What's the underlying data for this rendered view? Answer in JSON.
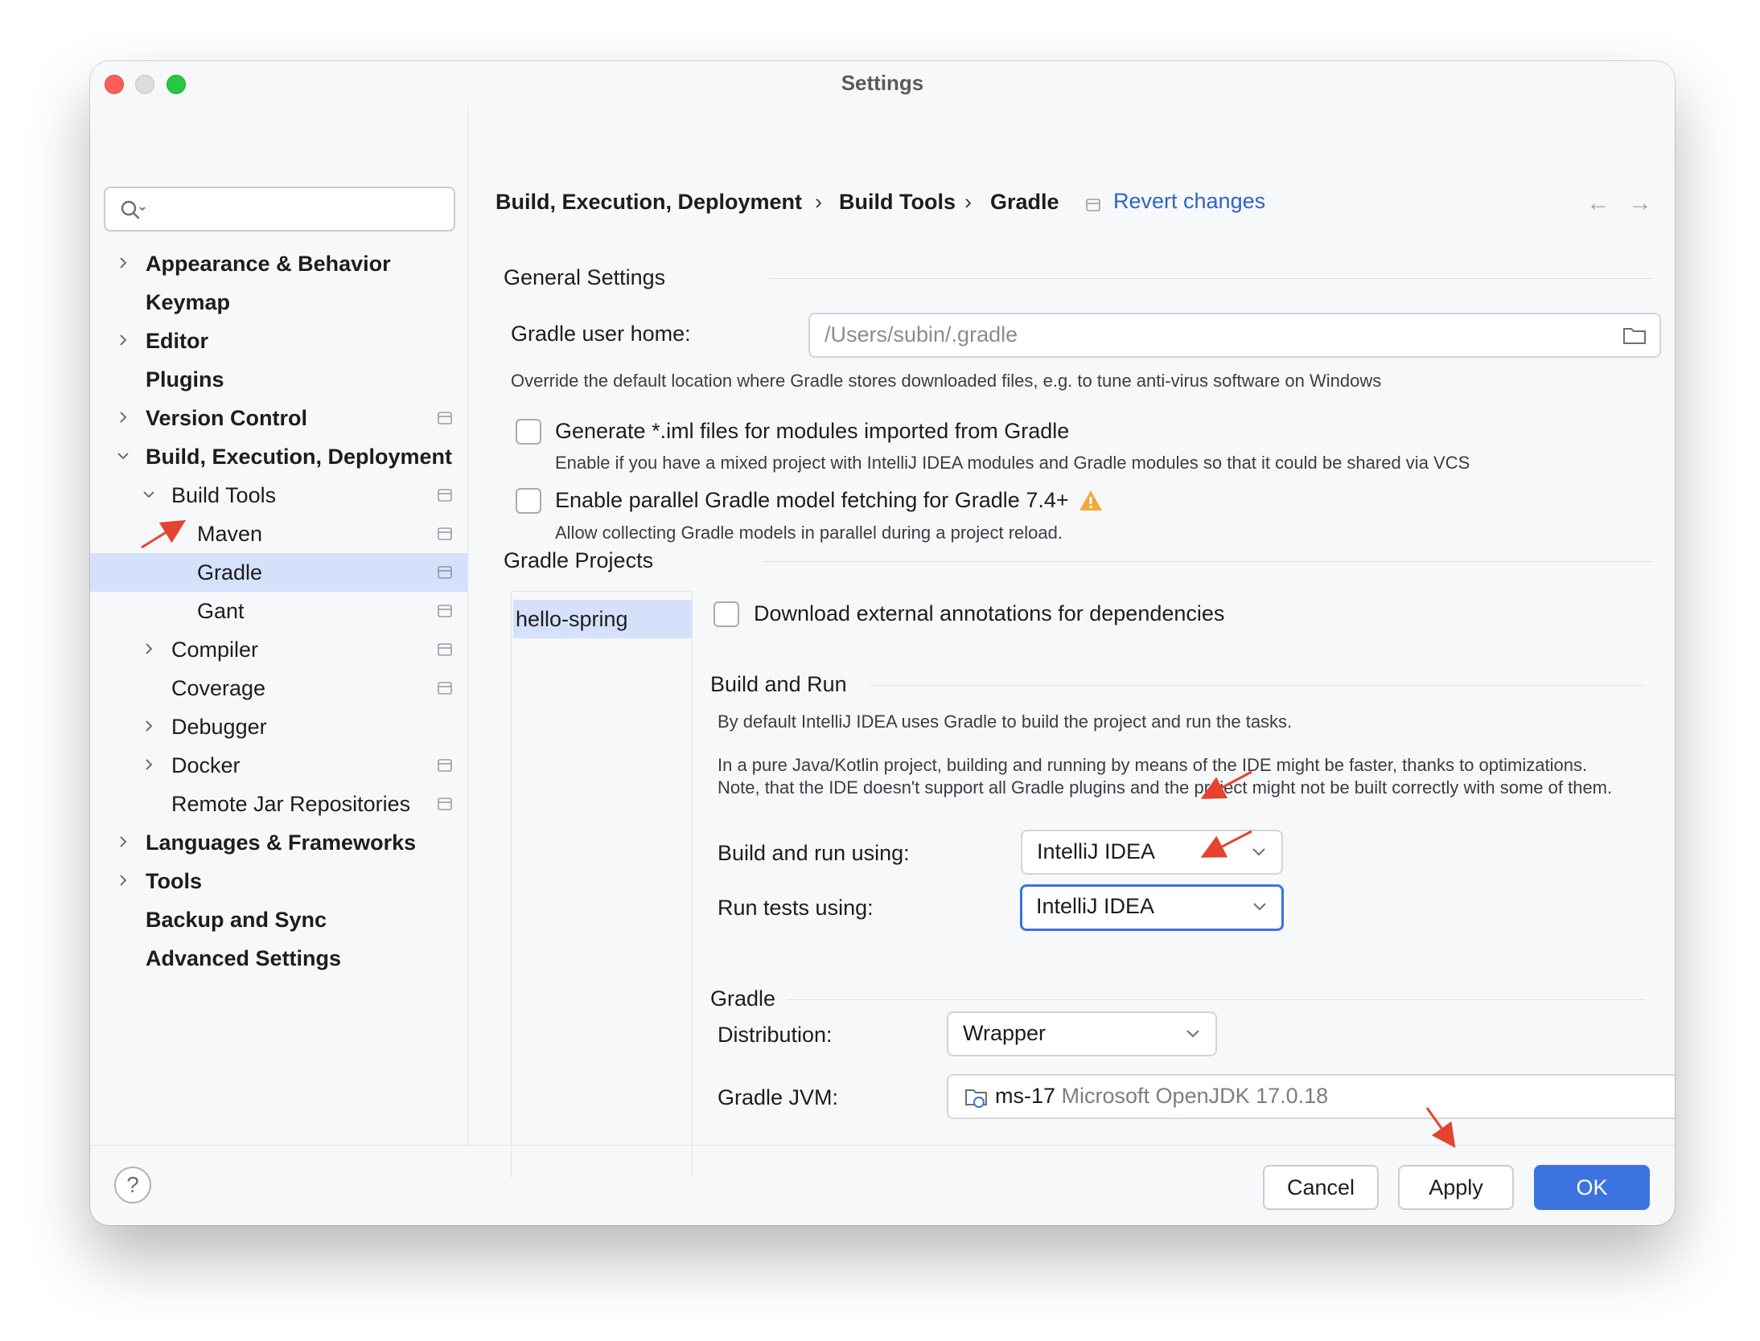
{
  "window": {
    "title": "Settings"
  },
  "sidebar": {
    "search_placeholder": "",
    "items": [
      {
        "label": "Appearance & Behavior"
      },
      {
        "label": "Keymap"
      },
      {
        "label": "Editor"
      },
      {
        "label": "Plugins"
      },
      {
        "label": "Version Control"
      },
      {
        "label": "Build, Execution, Deployment"
      },
      {
        "label": "Build Tools"
      },
      {
        "label": "Maven"
      },
      {
        "label": "Gradle"
      },
      {
        "label": "Gant"
      },
      {
        "label": "Compiler"
      },
      {
        "label": "Coverage"
      },
      {
        "label": "Debugger"
      },
      {
        "label": "Docker"
      },
      {
        "label": "Remote Jar Repositories"
      },
      {
        "label": "Languages & Frameworks"
      },
      {
        "label": "Tools"
      },
      {
        "label": "Backup and Sync"
      },
      {
        "label": "Advanced Settings"
      }
    ]
  },
  "breadcrumb": {
    "items": [
      "Build, Execution, Deployment",
      "Build Tools",
      "Gradle"
    ],
    "separator": "›",
    "revert": "Revert changes",
    "back": "←",
    "forward": "→"
  },
  "general": {
    "title": "General Settings",
    "gradle_home_label": "Gradle user home:",
    "gradle_home_placeholder": "/Users/subin/.gradle",
    "gradle_home_hint": "Override the default location where Gradle stores downloaded files, e.g. to tune anti-virus software on Windows",
    "iml_label": "Generate *.iml files for modules imported from Gradle",
    "iml_hint": "Enable if you have a mixed project with IntelliJ IDEA modules and Gradle modules so that it could be shared via VCS",
    "parallel_label": "Enable parallel Gradle model fetching for Gradle 7.4+",
    "parallel_hint": "Allow collecting Gradle models in parallel during a project reload."
  },
  "projects": {
    "title": "Gradle Projects",
    "items": [
      "hello-spring"
    ],
    "annotations_label": "Download external annotations for dependencies",
    "build_run": {
      "title": "Build and Run",
      "desc1": "By default IntelliJ IDEA uses Gradle to build the project and run the tasks.",
      "desc2": "In a pure Java/Kotlin project, building and running by means of the IDE might be faster, thanks to optimizations. Note, that the IDE doesn't support all Gradle plugins and the project might not be built correctly with some of them.",
      "build_label": "Build and run using:",
      "build_value": "IntelliJ IDEA",
      "tests_label": "Run tests using:",
      "tests_value": "IntelliJ IDEA"
    },
    "gradle": {
      "title": "Gradle",
      "distribution_label": "Distribution:",
      "distribution_value": "Wrapper",
      "jvm_label": "Gradle JVM:",
      "jvm_name": "ms-17",
      "jvm_detail": "Microsoft OpenJDK 17.0.18"
    }
  },
  "footer": {
    "help": "?",
    "cancel": "Cancel",
    "apply": "Apply",
    "ok": "OK"
  },
  "colors": {
    "accent": "#3b74e0",
    "selection": "#d5e1fb",
    "link": "#2f63c6",
    "annotation_arrow": "#e5432f",
    "warning": "#f2a93b"
  }
}
